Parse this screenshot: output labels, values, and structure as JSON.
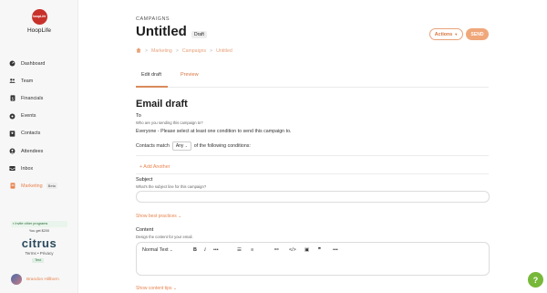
{
  "sidebar": {
    "logo_text": "hoopLife",
    "app_name": "HoopLife",
    "items": [
      {
        "label": "Dashboard",
        "icon": "dashboard-icon"
      },
      {
        "label": "Team",
        "icon": "team-icon"
      },
      {
        "label": "Financials",
        "icon": "financials-icon"
      },
      {
        "label": "Events",
        "icon": "events-icon"
      },
      {
        "label": "Contacts",
        "icon": "contacts-icon"
      },
      {
        "label": "Attendees",
        "icon": "attendees-icon"
      },
      {
        "label": "Inbox",
        "icon": "inbox-icon"
      },
      {
        "label": "Marketing",
        "icon": "marketing-icon",
        "badge": "Beta",
        "active": true
      }
    ],
    "invite": "Invite other programs",
    "you_get": "You get $200",
    "brand": "citrus",
    "terms": "Terms  •  Privacy",
    "test": "Test",
    "user_name": "Brandon Hillborn"
  },
  "header": {
    "section": "CAMPAIGNS",
    "title": "Untitled",
    "status": "Draft",
    "actions_label": "Actions",
    "send_label": "SEND",
    "breadcrumb": [
      "Marketing",
      "Campaigns",
      "Untitled"
    ]
  },
  "tabs": {
    "edit": "Edit draft",
    "preview": "Preview"
  },
  "form": {
    "heading": "Email draft",
    "to_label": "To",
    "to_sub": "Who are you sending this campaign to?",
    "to_value": "Everyone - Please select at least one condition to send this campaign to.",
    "contacts_match": "Contacts match",
    "match_value": "Any",
    "match_suffix": "of the following conditions:",
    "add_another": "Add Another",
    "subject_label": "Subject",
    "subject_sub": "What's the subject line for this campaign?",
    "best_practices": "Show best practices",
    "content_label": "Content",
    "content_sub": "Design the content for your email.",
    "text_style": "Normal Text",
    "content_tips": "Show content tips"
  },
  "help": "?",
  "colors": {
    "accent": "#e8844f",
    "send_bg": "#f0a77a",
    "logo": "#c8312b",
    "help": "#77b83a"
  }
}
